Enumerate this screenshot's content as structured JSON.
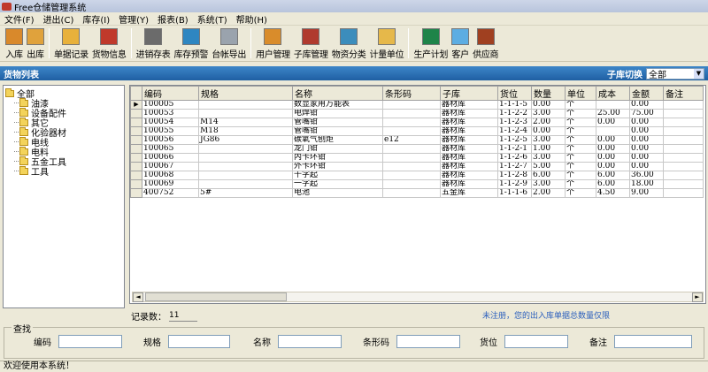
{
  "window": {
    "title": "Free仓储管理系统"
  },
  "menu": [
    "文件(F)",
    "进出(C)",
    "库存(I)",
    "管理(Y)",
    "报表(B)",
    "系统(T)",
    "帮助(H)"
  ],
  "toolbar": [
    {
      "label": "入库",
      "icon": "inbound-icon",
      "color": "#d9892b"
    },
    {
      "label": "出库",
      "icon": "outbound-icon",
      "color": "#e0a23c"
    },
    {
      "label": "单据记录",
      "icon": "document-record-icon",
      "color": "#e8b13b"
    },
    {
      "label": "货物信息",
      "icon": "goods-info-icon",
      "color": "#c0392b"
    },
    {
      "label": "进销存表",
      "icon": "chart-table-icon",
      "color": "#6b6b6b"
    },
    {
      "label": "库存预警",
      "icon": "inventory-alert-icon",
      "color": "#2e86c1"
    },
    {
      "label": "台帐导出",
      "icon": "ledger-export-icon",
      "color": "#9aa3ad"
    },
    {
      "label": "用户管理",
      "icon": "user-manage-icon",
      "color": "#d98c2b"
    },
    {
      "label": "子库管理",
      "icon": "sub-warehouse-icon",
      "color": "#b03a2e"
    },
    {
      "label": "物资分类",
      "icon": "material-category-icon",
      "color": "#3c8dbc"
    },
    {
      "label": "计量单位",
      "icon": "unit-measure-icon",
      "color": "#e6b84a"
    },
    {
      "label": "生产计划",
      "icon": "production-plan-icon",
      "color": "#1e8449"
    },
    {
      "label": "客户",
      "icon": "customer-icon",
      "color": "#5dade2"
    },
    {
      "label": "供应商",
      "icon": "supplier-icon",
      "color": "#a04020"
    }
  ],
  "panel": {
    "title": "货物列表",
    "switch_label": "子库切换",
    "switch_value": "全部"
  },
  "tree": {
    "root": "全部",
    "children": [
      "油漆",
      "设备配件",
      "其它",
      "化验器材",
      "电线",
      "电料",
      "五金工具",
      "工具"
    ]
  },
  "grid": {
    "columns": [
      "编码",
      "规格",
      "名称",
      "条形码",
      "子库",
      "货位",
      "数量",
      "单位",
      "成本",
      "金额",
      "备注"
    ],
    "rows": [
      [
        "100005",
        "",
        "数显家用万能表",
        "",
        "器材库",
        "1-1-1-5",
        "0.00",
        "个",
        "",
        "0.00",
        ""
      ],
      [
        "100053",
        "",
        "电焊钳",
        "",
        "器材库",
        "1-1-2-2",
        "3.00",
        "个",
        "25.00",
        "75.00",
        ""
      ],
      [
        "100054",
        "M14",
        "管嘴钳",
        "",
        "器材库",
        "1-1-2-3",
        "2.00",
        "个",
        "0.00",
        "0.00",
        ""
      ],
      [
        "100055",
        "M18",
        "管嘴钳",
        "",
        "器材库",
        "1-1-2-4",
        "0.00",
        "个",
        "",
        "0.00",
        ""
      ],
      [
        "100056",
        "JG86",
        "碳氧气刨炬",
        "e12",
        "器材库",
        "1-1-2-5",
        "3.00",
        "个",
        "0.00",
        "0.00",
        ""
      ],
      [
        "100065",
        "",
        "龙门钳",
        "",
        "器材库",
        "1-1-2-1",
        "1.00",
        "个",
        "0.00",
        "0.00",
        ""
      ],
      [
        "100066",
        "",
        "内卡环钳",
        "",
        "器材库",
        "1-1-2-6",
        "3.00",
        "个",
        "0.00",
        "0.00",
        ""
      ],
      [
        "100067",
        "",
        "外卡环钳",
        "",
        "器材库",
        "1-1-2-7",
        "5.00",
        "个",
        "0.00",
        "0.00",
        ""
      ],
      [
        "100068",
        "",
        "十字起",
        "",
        "器材库",
        "1-1-2-8",
        "6.00",
        "个",
        "6.00",
        "36.00",
        ""
      ],
      [
        "100069",
        "",
        "一字起",
        "",
        "器材库",
        "1-1-2-9",
        "3.00",
        "个",
        "6.00",
        "18.00",
        ""
      ],
      [
        "400752",
        "5#",
        "电池",
        "",
        "五金库",
        "1-1-1-6",
        "2.00",
        "个",
        "4.50",
        "9.00",
        ""
      ]
    ]
  },
  "record": {
    "label": "记录数：",
    "count": "11"
  },
  "notice": "未注册，您的出入库单据总数量仅限",
  "search": {
    "title": "查找",
    "fields": [
      "编码",
      "规格",
      "名称",
      "条形码",
      "货位",
      "备注"
    ]
  },
  "status": "欢迎使用本系统！"
}
